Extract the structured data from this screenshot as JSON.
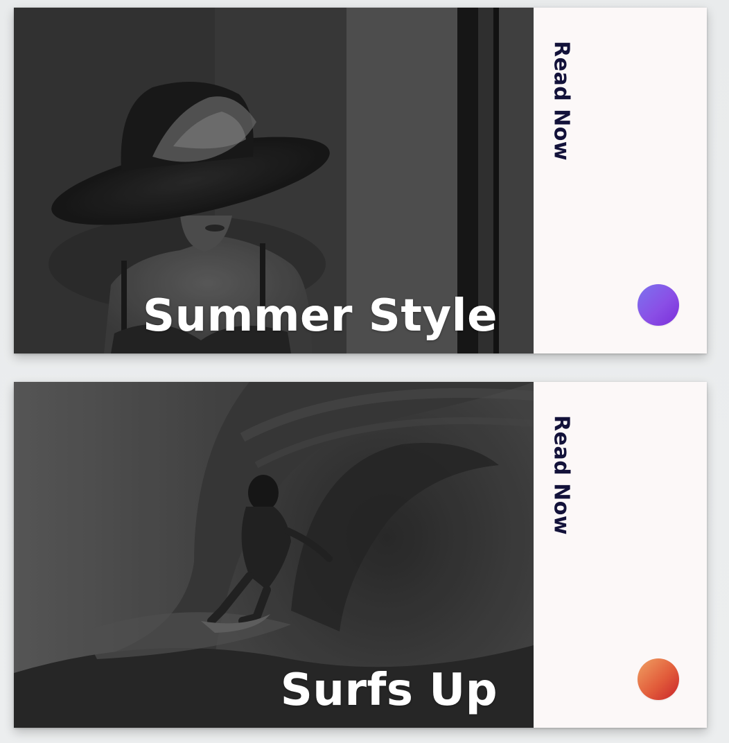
{
  "cards": [
    {
      "title": "Summer Style",
      "cta_label": "Read Now",
      "image_subject": "woman-in-wide-brim-hat-photo",
      "accent_gradient": [
        "#7c73ee",
        "#7b2fd9"
      ]
    },
    {
      "title": "Surfs Up",
      "cta_label": "Read Now",
      "image_subject": "surfer-in-wave-barrel-photo",
      "accent_gradient": [
        "#f0a063",
        "#c9242a"
      ]
    }
  ]
}
